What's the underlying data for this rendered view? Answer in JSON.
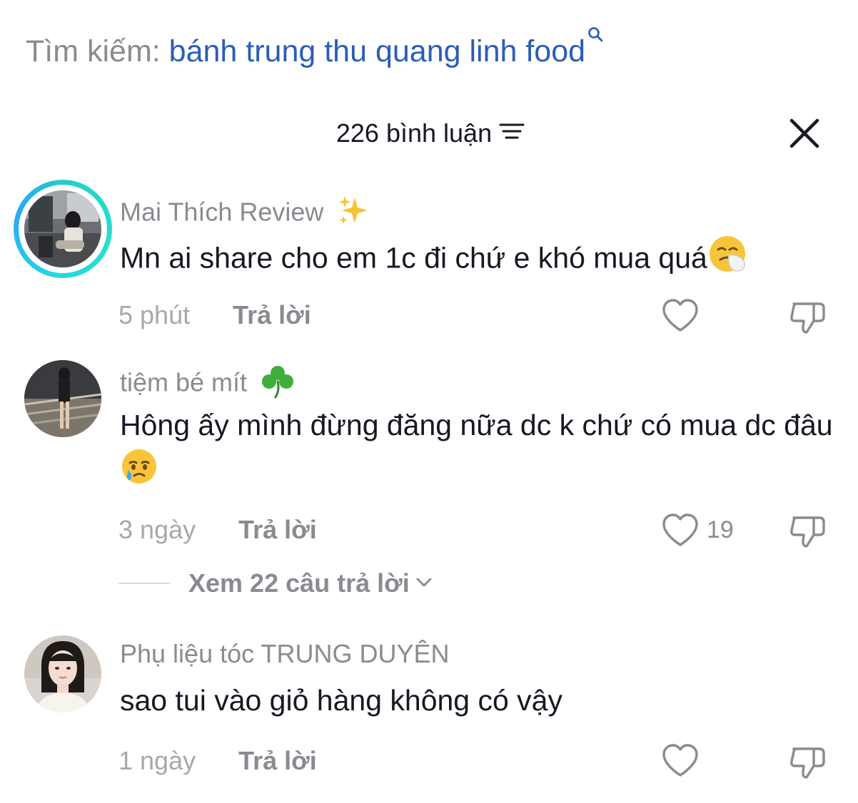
{
  "search": {
    "prefix": "Tìm kiếm: ",
    "query": "bánh trung thu quang linh food"
  },
  "header": {
    "title": "226 bình luận"
  },
  "comments": [
    {
      "username": "Mai Thích Review",
      "user_emoji": "sparkles-emoji",
      "text": "Mn ai share cho em 1c đi chứ e khó mua quá",
      "text_emoji": "sneezing-face-emoji",
      "time": "5 phút",
      "reply_label": "Trả lời",
      "likes": ""
    },
    {
      "username": "tiệm bé mít",
      "user_emoji": "shamrock-emoji",
      "text": "Hông ấy mình đừng đăng nữa dc k chứ có mua dc đâu",
      "text_emoji": "sad-but-relieved-face-emoji",
      "time": "3 ngày",
      "reply_label": "Trả lời",
      "likes": "19",
      "view_replies": "Xem 22 câu trả lời"
    },
    {
      "username": "Phụ liệu tóc TRUNG DUYÊN",
      "text": "sao tui vào giỏ hàng không có vậy",
      "time": "1 ngày",
      "reply_label": "Trả lời",
      "likes": ""
    }
  ],
  "colors": {
    "link_blue": "#2b5db6",
    "muted_text": "#8a8b91",
    "primary_text": "#161823",
    "story_ring": "#25d5e8"
  }
}
